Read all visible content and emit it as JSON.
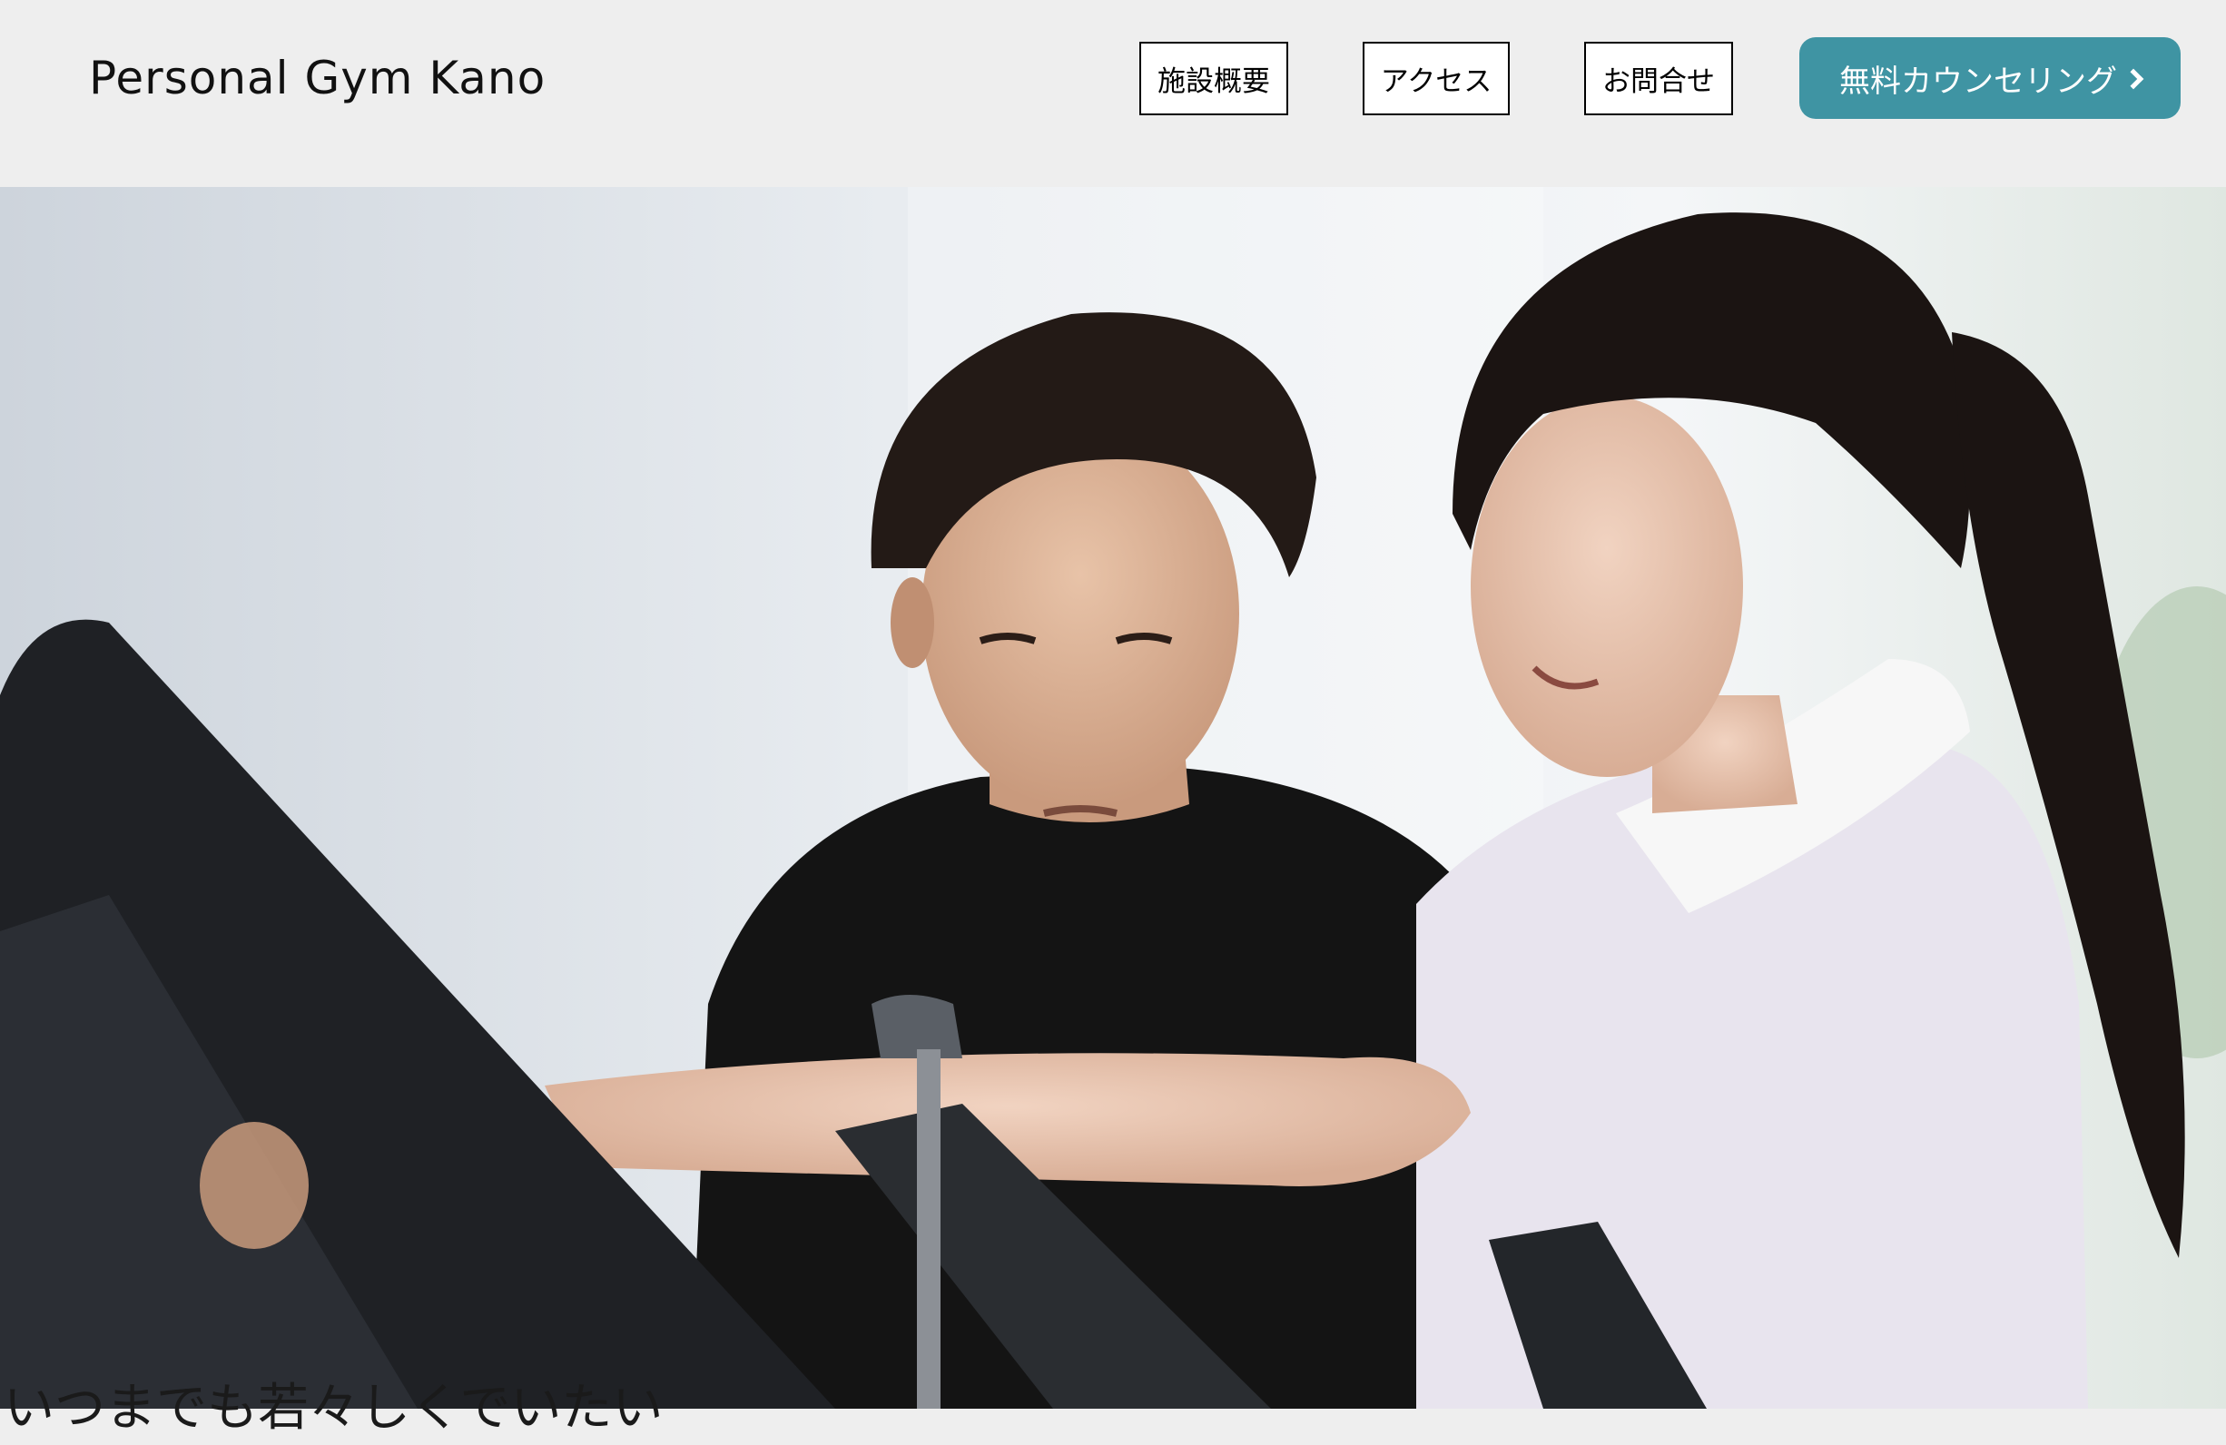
{
  "header": {
    "logo": "Personal Gym Kano",
    "nav": [
      {
        "label": "施設概要"
      },
      {
        "label": "アクセス"
      },
      {
        "label": "お問合せ"
      }
    ],
    "cta_label": "無料カウンセリング"
  },
  "hero": {
    "image": "gym-trainer-photo",
    "tagline": "いつまでも若々しくでいたい"
  },
  "colors": {
    "header_bg": "#eeeeee",
    "accent": "#3f94a3"
  }
}
